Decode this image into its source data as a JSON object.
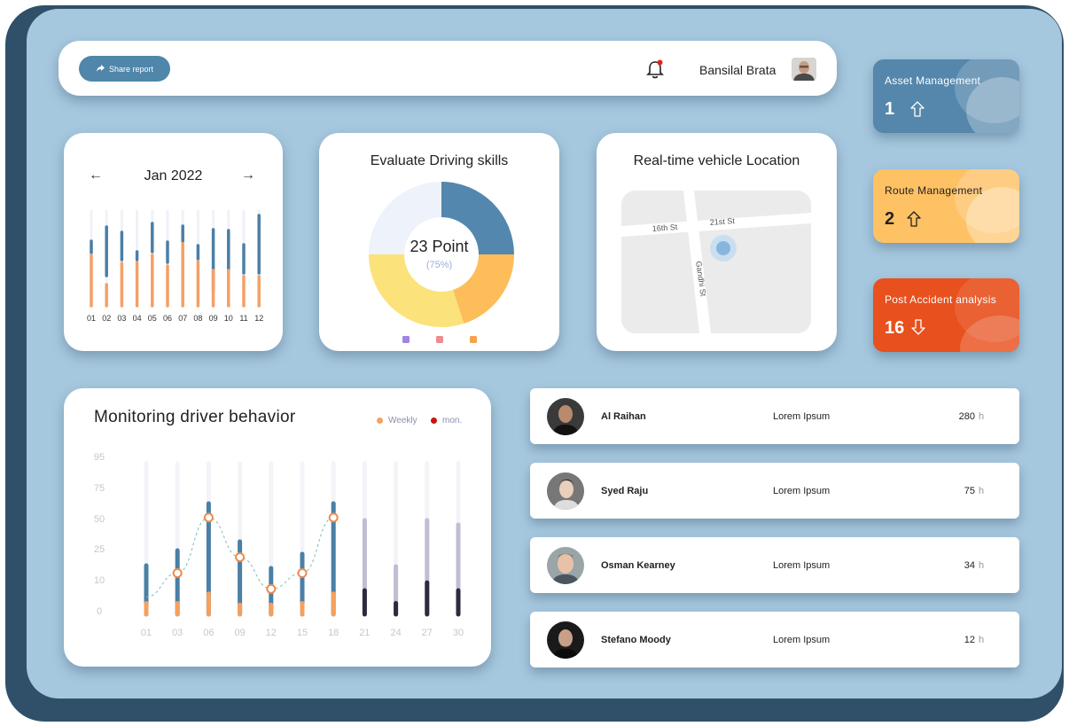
{
  "header": {
    "share_label": "Share report",
    "user_name": "Bansilal Brata"
  },
  "calendar": {
    "month": "Jan 2022",
    "prev_icon": "arrow-left-icon",
    "next_icon": "arrow-right-icon",
    "days": [
      "01",
      "02",
      "03",
      "04",
      "05",
      "06",
      "07",
      "08",
      "09",
      "10",
      "11",
      "12"
    ]
  },
  "skills": {
    "title": "Evaluate Driving skills",
    "center_value": "23 Point",
    "center_percent": "(75%)",
    "legend_colors": [
      "#9f86e6",
      "#f08c8c",
      "#f9a24e"
    ],
    "segments": [
      {
        "color": "#5387ad",
        "fraction": 0.25
      },
      {
        "color": "#fdbd5a",
        "fraction": 0.2
      },
      {
        "color": "#fbe27a",
        "fraction": 0.3
      },
      {
        "color": "#eef2fa",
        "fraction": 0.25
      }
    ]
  },
  "location": {
    "title": "Real-time vehicle Location",
    "streets": [
      "16th St",
      "21st St",
      "Gandhi St"
    ]
  },
  "tiles": [
    {
      "label": "Asset Management",
      "count": "1",
      "direction": "up",
      "bg": "#5487ab",
      "fg": "#ffffff"
    },
    {
      "label": "Route Management",
      "count": "2",
      "direction": "up",
      "bg": "#fec164",
      "fg": "#222222"
    },
    {
      "label": "Post Accident analysis",
      "count": "16",
      "direction": "down",
      "bg": "#e8501d",
      "fg": "#ffffff"
    }
  ],
  "monitor": {
    "title": "Monitoring driver behavior",
    "legend": [
      {
        "label": "Weekly",
        "color": "#f6a25a"
      },
      {
        "label": "mon.",
        "color": "#cc1111"
      }
    ]
  },
  "chart_data": {
    "type": "bar",
    "title": "Monitoring driver behavior",
    "yticks": [
      95,
      75,
      50,
      25,
      10,
      0
    ],
    "categories": [
      "01",
      "03",
      "06",
      "09",
      "12",
      "15",
      "18",
      "21",
      "24",
      "27",
      "30"
    ],
    "series": [
      {
        "name": "Weekly",
        "values": [
          7,
          7,
          13,
          6,
          6,
          7,
          13,
          null,
          null,
          null,
          null
        ]
      },
      {
        "name": "mon.",
        "values": [
          null,
          null,
          null,
          null,
          null,
          null,
          null,
          15,
          7,
          20,
          15
        ]
      }
    ],
    "line_values": [
      11,
      26,
      61,
      36,
      16,
      26,
      61
    ],
    "ylim": [
      0,
      95
    ]
  },
  "drivers": [
    {
      "name": "Al Raihan",
      "desc": "Lorem Ipsum",
      "hours": "280",
      "unit": "h"
    },
    {
      "name": "Syed Raju",
      "desc": "Lorem Ipsum",
      "hours": "75",
      "unit": "h"
    },
    {
      "name": "Osman Kearney",
      "desc": "Lorem Ipsum",
      "hours": "34",
      "unit": "h"
    },
    {
      "name": "Stefano Moody",
      "desc": "Lorem Ipsum",
      "hours": "12",
      "unit": "h"
    }
  ]
}
